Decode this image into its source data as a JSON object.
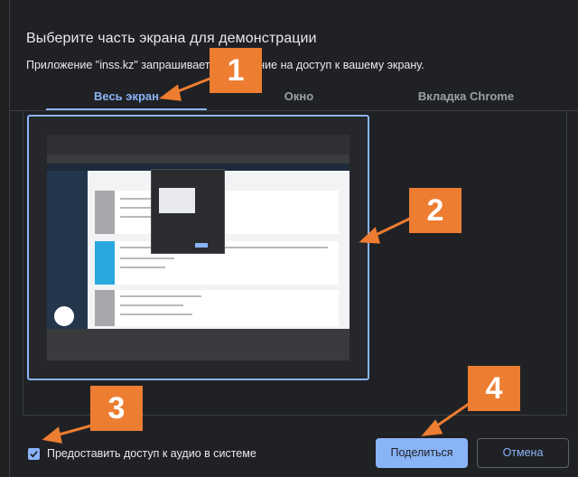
{
  "dialog": {
    "title": "Выберите часть экрана для демонстрации",
    "subtitle": "Приложение \"inss.kz\" запрашивает разрешение на доступ к вашему экрану."
  },
  "tabs": [
    {
      "label": "Весь экран",
      "active": true
    },
    {
      "label": "Окно",
      "active": false
    },
    {
      "label": "Вкладка Chrome",
      "active": false
    }
  ],
  "audio": {
    "label": "Предоставить доступ к аудио в системе",
    "checked": true
  },
  "buttons": {
    "share": "Поделиться",
    "cancel": "Отмена"
  },
  "annotations": [
    "1",
    "2",
    "3",
    "4"
  ],
  "colors": {
    "accent": "#8ab4f8",
    "marker": "#ed7d31",
    "background": "#202124"
  }
}
